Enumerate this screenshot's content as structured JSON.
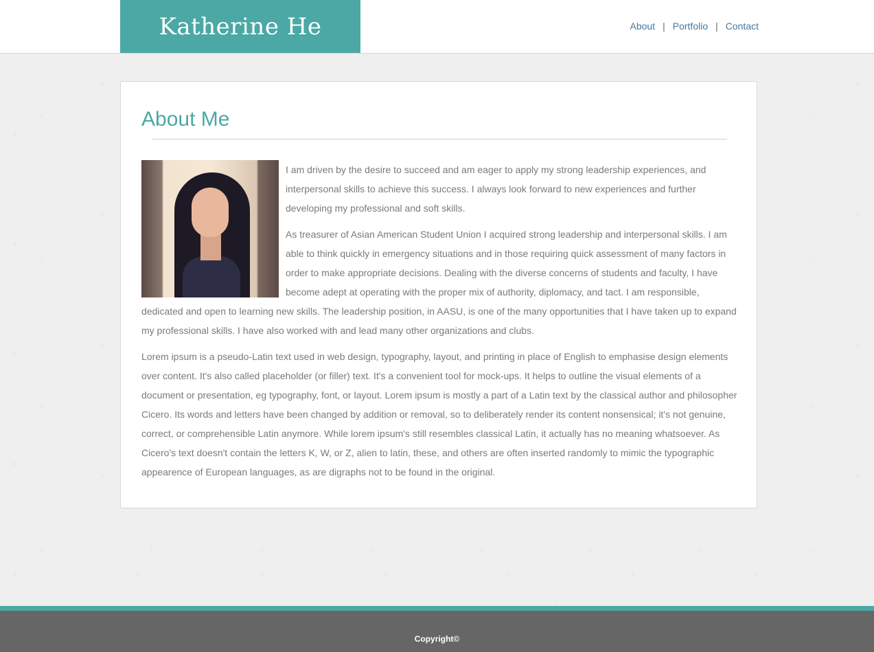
{
  "header": {
    "brand": "Katherine He",
    "nav": [
      {
        "label": "About"
      },
      {
        "label": "Portfolio"
      },
      {
        "label": "Contact"
      }
    ],
    "separator": "|"
  },
  "about": {
    "title": "About Me",
    "photo_alt": "profile-photo",
    "paragraphs": [
      "I am driven by the desire to succeed and am eager to apply my strong leadership experiences, and interpersonal skills to achieve this success. I always look forward to new experiences and further developing my professional and soft skills.",
      "As treasurer of Asian American Student Union I acquired strong leadership and interpersonal skills. I am able to think quickly in emergency situations and in those requiring quick assessment of many factors in order to make appropriate decisions. Dealing with the diverse concerns of students and faculty, I have become adept at operating with the proper mix of authority, diplomacy, and tact. I am responsible, dedicated and open to learning new skills. The leadership position, in AASU, is one of the many opportunities that I have taken up to expand my professional skills. I have also worked with and lead many other organizations and clubs.",
      "Lorem ipsum is a pseudo-Latin text used in web design, typography, layout, and printing in place of English to emphasise design elements over content. It's also called placeholder (or filler) text. It's a convenient tool for mock-ups. It helps to outline the visual elements of a document or presentation, eg typography, font, or layout. Lorem ipsum is mostly a part of a Latin text by the classical author and philosopher Cicero. Its words and letters have been changed by addition or removal, so to deliberately render its content nonsensical; it's not genuine, correct, or comprehensible Latin anymore. While lorem ipsum's still resembles classical Latin, it actually has no meaning whatsoever. As Cicero's text doesn't contain the letters K, W, or Z, alien to latin, these, and others are often inserted randomly to mimic the typographic appearence of European languages, as are digraphs not to be found in the original."
    ]
  },
  "footer": {
    "copyright": "Copyright©"
  },
  "colors": {
    "accent": "#4ba8a5",
    "link": "#3f7aa5",
    "body_text": "#7a7a7a",
    "footer_bg": "#666666"
  }
}
